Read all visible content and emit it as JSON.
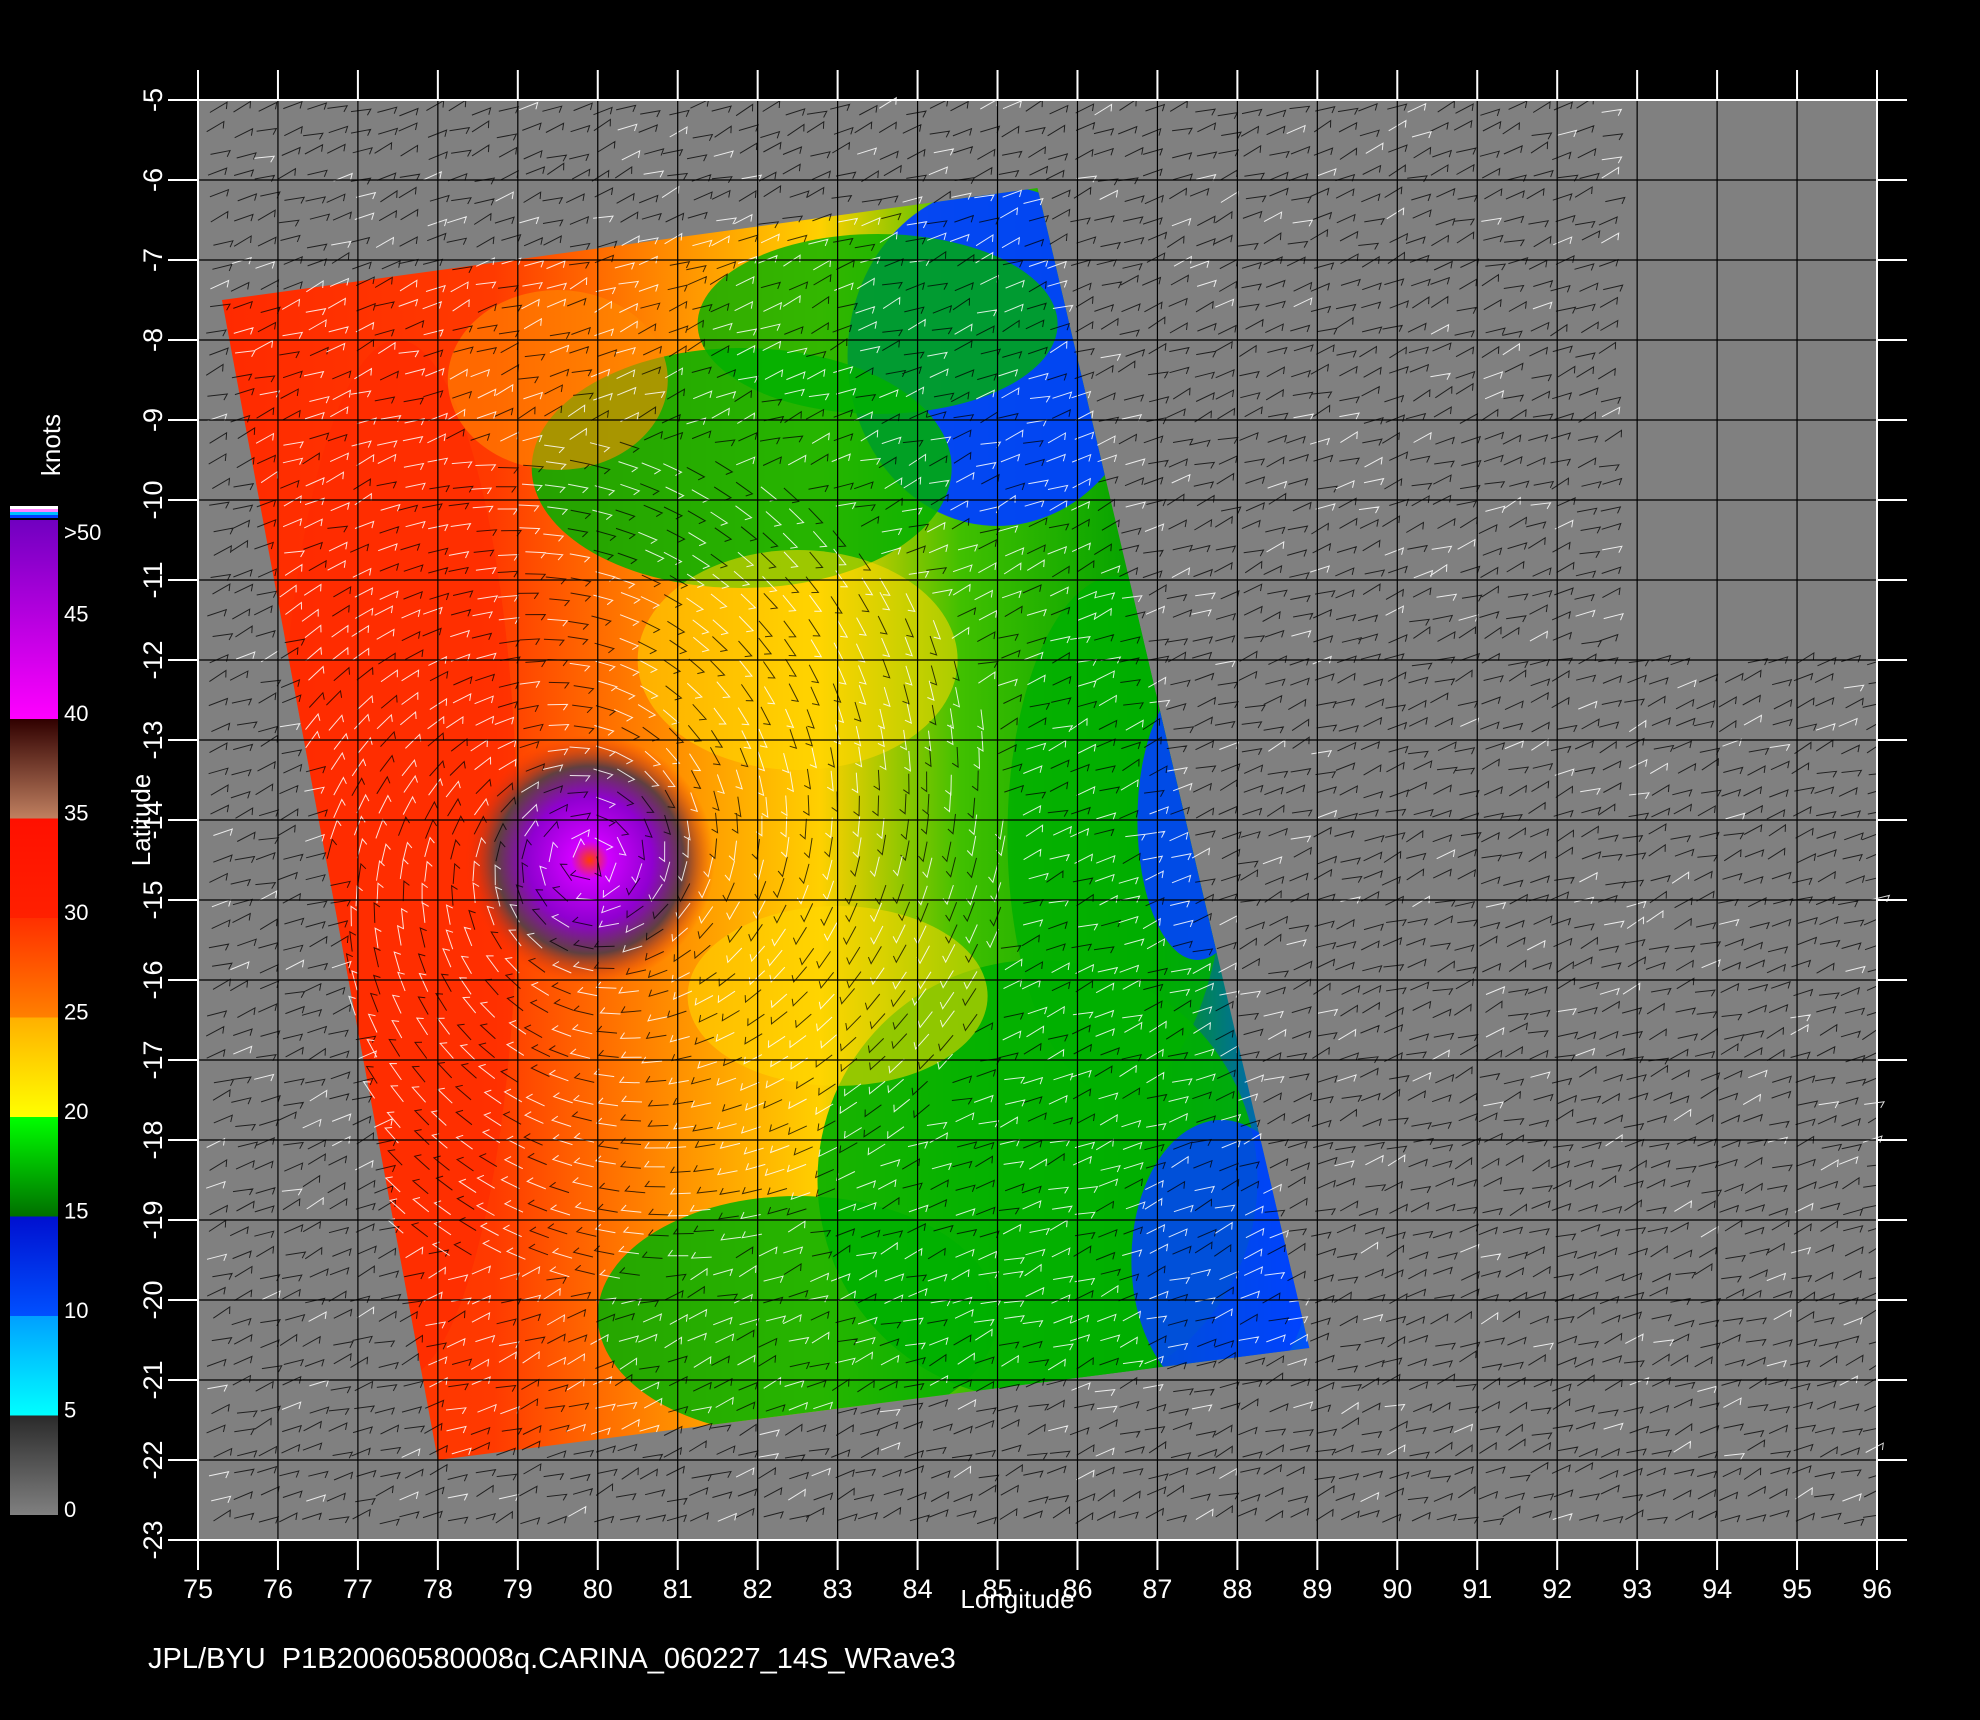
{
  "caption": "JPL/BYU  P1B20060580008q.CARINA_060227_14S_WRave3",
  "axes": {
    "x": {
      "label": "Longitude",
      "min": 75,
      "max": 96,
      "ticks": [
        "75",
        "76",
        "77",
        "78",
        "79",
        "80",
        "81",
        "82",
        "83",
        "84",
        "85",
        "86",
        "87",
        "88",
        "89",
        "90",
        "91",
        "92",
        "93",
        "94",
        "95",
        "96"
      ]
    },
    "y": {
      "label": "Latitude",
      "min": -23,
      "max": -5,
      "ticks": [
        "-5",
        "-6",
        "-7",
        "-8",
        "-9",
        "-10",
        "-11",
        "-12",
        "-13",
        "-14",
        "-15",
        "-16",
        "-17",
        "-18",
        "-19",
        "-20",
        "-21",
        "-22",
        "-23"
      ]
    },
    "grid": true
  },
  "colorbar": {
    "unit": "knots",
    "labels": [
      ">50",
      "45",
      "40",
      "35",
      "30",
      "25",
      "20",
      "15",
      "10",
      "5",
      "0"
    ],
    "bands": [
      {
        "from": 0,
        "to": 5,
        "colors": [
          "#808080",
          "#2a2a2a"
        ]
      },
      {
        "from": 5,
        "to": 10,
        "colors": [
          "#00ffff",
          "#00a0ff"
        ]
      },
      {
        "from": 10,
        "to": 15,
        "colors": [
          "#0050ff",
          "#0010d0"
        ]
      },
      {
        "from": 15,
        "to": 20,
        "colors": [
          "#007000",
          "#00ff00"
        ]
      },
      {
        "from": 20,
        "to": 25,
        "colors": [
          "#ffff00",
          "#ffb000"
        ]
      },
      {
        "from": 25,
        "to": 30,
        "colors": [
          "#ff8000",
          "#ff3000"
        ]
      },
      {
        "from": 30,
        "to": 35,
        "colors": [
          "#ff2000",
          "#ff1000"
        ]
      },
      {
        "from": 35,
        "to": 40,
        "colors": [
          "#c08060",
          "#300000"
        ]
      },
      {
        "from": 40,
        "to": 50,
        "colors": [
          "#ff00ff",
          "#7000c0"
        ]
      }
    ]
  },
  "map_colors": {
    "background": "#808080",
    "land_frame": "#000000",
    "swath_red": "#ff2a00",
    "swath_orange": "#ff8a00",
    "swath_yellow": "#ffd800",
    "swath_green": "#00b000",
    "swath_blue": "#0040ff",
    "eye_purple": "#b000e0"
  },
  "swath": {
    "corners_lon_lat": [
      [
        75.3,
        -7.5
      ],
      [
        85.5,
        -6.1
      ],
      [
        88.9,
        -20.6
      ],
      [
        78.0,
        -22.0
      ]
    ]
  },
  "storm_center": {
    "lon": 79.9,
    "lat": -14.5
  }
}
